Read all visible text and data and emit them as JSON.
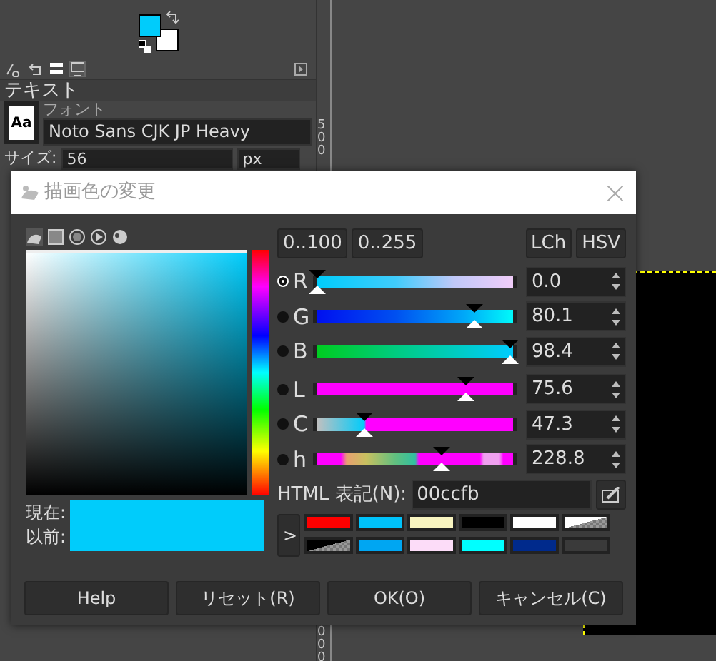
{
  "dock": {
    "tabs": [
      {
        "selected": false
      },
      {
        "selected": false
      },
      {
        "selected": false
      },
      {
        "selected": true
      }
    ],
    "title": "テキスト",
    "font_preview": "Aa",
    "font_label": "フォント",
    "font_value": "Noto Sans CJK JP Heavy",
    "size_label": "サイズ:",
    "size_value": "56",
    "unit": "px"
  },
  "color_swatches": [
    {
      "kind": "foreground",
      "color": "#00ccfb"
    },
    {
      "kind": "background",
      "color": "#ffffff"
    }
  ],
  "ruler": {
    "labels": [
      "500",
      "000"
    ]
  },
  "dialog": {
    "title": "描画色の変更",
    "selector_tabs": [
      {
        "selected": true
      },
      {
        "selected": false
      },
      {
        "selected": false
      },
      {
        "selected": false
      },
      {
        "selected": false
      }
    ],
    "range_buttons": [
      "0..100",
      "0..255"
    ],
    "model_buttons": [
      "LCh",
      "HSV"
    ],
    "channels": [
      {
        "label": "R",
        "selected": true,
        "level": 0.0,
        "value": "0.0"
      },
      {
        "label": "G",
        "selected": false,
        "level": 0.801,
        "value": "80.1"
      },
      {
        "label": "B",
        "selected": false,
        "level": 0.984,
        "value": "98.4"
      },
      {
        "label": "L",
        "selected": false,
        "level": 0.756,
        "value": "75.6"
      },
      {
        "label": "C",
        "selected": false,
        "level": 0.24,
        "value": "47.3"
      },
      {
        "label": "h",
        "selected": false,
        "level": 0.636,
        "value": "228.8"
      }
    ],
    "html_label": "HTML 表記(N):",
    "html_value": "00ccfb",
    "current_label": "現在:",
    "previous_label": "以前:",
    "swatch": {
      "color": "#00ccfb"
    },
    "history_toggle": ">",
    "history": [
      {
        "kind": "solid",
        "color": "#ff0000"
      },
      {
        "kind": "solid",
        "color": "#00c3fb"
      },
      {
        "kind": "solid",
        "color": "#f8f4c0"
      },
      {
        "kind": "solid",
        "color": "#000000"
      },
      {
        "kind": "solid",
        "color": "#ffffff"
      },
      {
        "kind": "fade",
        "color": "#ffffff"
      },
      {
        "kind": "fade",
        "color": "#000000"
      },
      {
        "kind": "solid",
        "color": "#00a6f2"
      },
      {
        "kind": "solid",
        "color": "#fcdcf8"
      },
      {
        "kind": "solid",
        "color": "#00ffff"
      },
      {
        "kind": "solid",
        "color": "#002a8c"
      },
      {
        "kind": "empty"
      }
    ],
    "buttons": [
      "Help",
      "リセット(R)",
      "OK(O)",
      "キャンセル(C)"
    ]
  }
}
